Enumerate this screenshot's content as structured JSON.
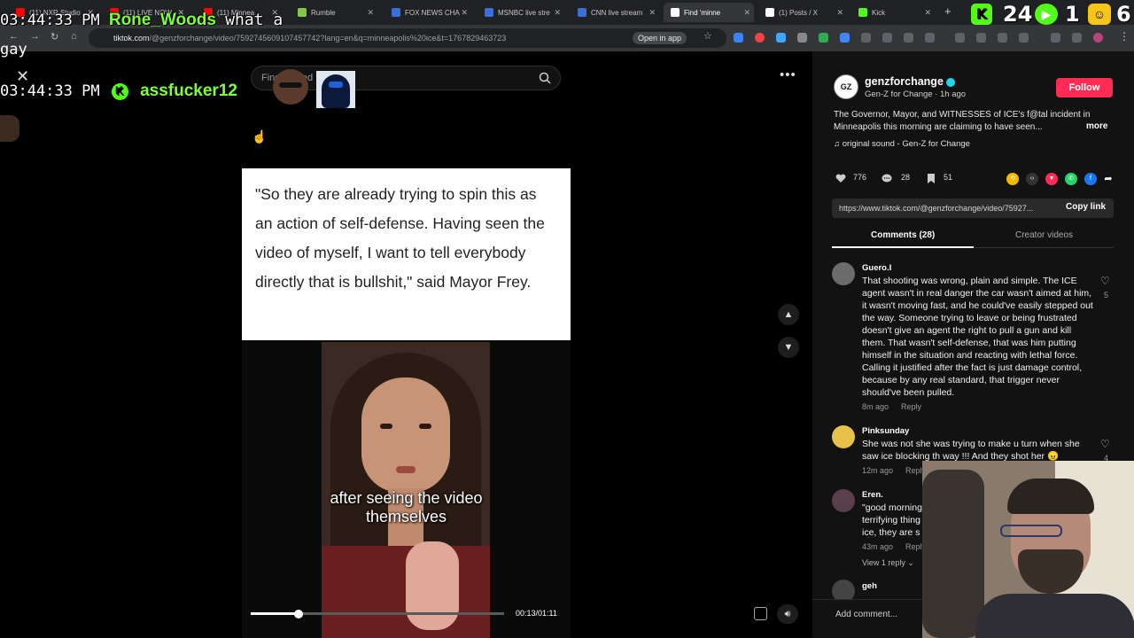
{
  "browser": {
    "tabs": [
      {
        "label": "(11) NXR Studio",
        "fav": "#ff0000"
      },
      {
        "label": "(11) LIVE NOW",
        "fav": "#ff0000"
      },
      {
        "label": "(11) Minnea",
        "fav": "#ff0000"
      },
      {
        "label": "Rumble",
        "fav": "#85c742"
      },
      {
        "label": "FOX NEWS CHA",
        "fav": "#3a6fd8"
      },
      {
        "label": "MSNBC live stre",
        "fav": "#3a6fd8"
      },
      {
        "label": "CNN live stream",
        "fav": "#3a6fd8"
      },
      {
        "label": "Find 'minne",
        "fav": "#ffffff"
      },
      {
        "label": "(1) Posts / X",
        "fav": "#ffffff"
      },
      {
        "label": "Kick",
        "fav": "#53fc18"
      }
    ],
    "url_host": "tiktok.com",
    "url_path": "/@genzforchange/video/7592745609107457742?lang=en&q=minneapolis%20ice&t=1767829463723",
    "open_in_app": "Open in app"
  },
  "overlay": {
    "line1_time": "03:44:33 PM",
    "line1_user": "Rone_Woods",
    "line1_msg": "what a",
    "line1_tail": "gay",
    "line2_time": "03:44:33 PM",
    "line2_badge": "K",
    "line2_user": "assfucker12",
    "counter_a": "24",
    "counter_b": "1",
    "counter_c": "6"
  },
  "search": {
    "placeholder": "Find related"
  },
  "video": {
    "quote": "\"So they are already trying to spin this as an action of self-defense. Having seen the video of myself, I want to tell everybody directly that is bullshit,\" said Mayor Frey.",
    "caption_line1": "after seeing the video",
    "caption_line2": "themselves",
    "timecode": "00:13/01:11",
    "progress": 0.19
  },
  "post": {
    "author": "genzforchange",
    "author_sub": "Gen-Z for Change · 1h ago",
    "follow_label": "Follow",
    "description": "The Governor, Mayor, and WITNESSES of ICE's f@tal incident in Minneapolis this morning are claiming to have seen...",
    "more_label": "more",
    "sound": "original sound - Gen-Z for Change",
    "likes": "776",
    "comments_count": "28",
    "saves": "51",
    "link": "https://www.tiktok.com/@genzforchange/video/75927...",
    "copy_link": "Copy link",
    "tab_comments": "Comments (28)",
    "tab_creator": "Creator videos",
    "add_comment": "Add comment..."
  },
  "comments": [
    {
      "user": "Guero.I",
      "text": "That shooting was wrong, plain and simple. The ICE agent wasn't in real danger the car wasn't aimed at him, it wasn't moving fast, and he could've easily stepped out the way. Someone trying to leave or being frustrated doesn't give an agent the right to pull a gun and kill them. That wasn't self-defense, that was him putting himself in the situation and reacting with lethal force. Calling it justified after the fact is just damage control, because by any real standard, that trigger never should've been pulled.",
      "time": "8m ago",
      "reply": "Reply",
      "likes": "5"
    },
    {
      "user": "Pinksunday",
      "text": "She was not she was trying to make u turn when she saw ice blocking th way !!! And they shot her 😠",
      "time": "12m ago",
      "reply": "Reply",
      "likes": "4"
    },
    {
      "user": "Eren.",
      "text": "\"good morning terrifying thing ice, they are s",
      "time": "43m ago",
      "reply": "Reply",
      "view_replies": "View 1 reply"
    },
    {
      "user": "geh"
    }
  ]
}
